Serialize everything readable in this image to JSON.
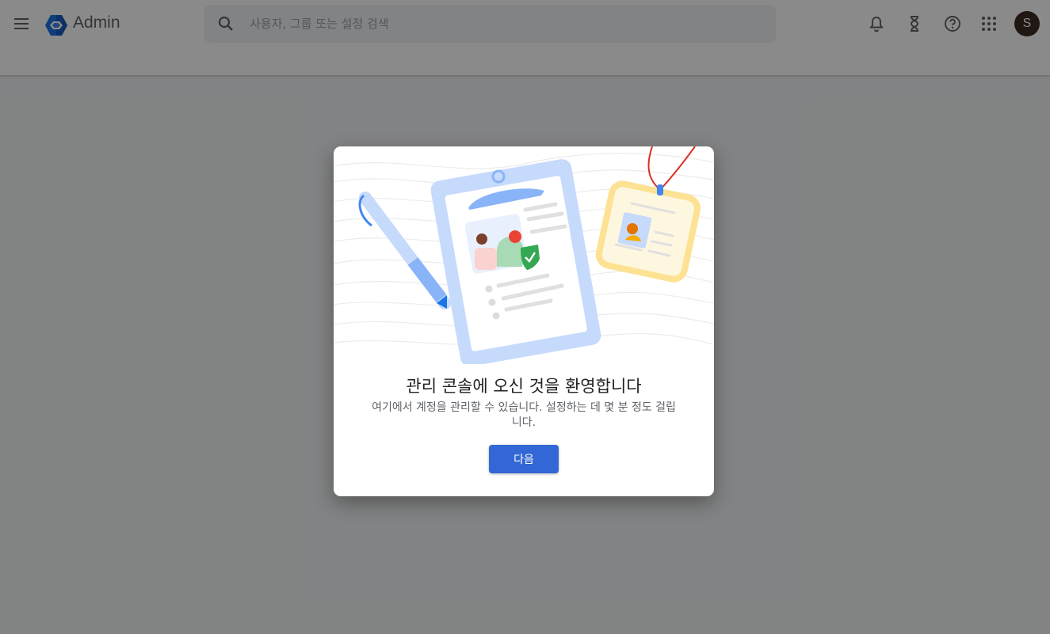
{
  "header": {
    "app_name": "Admin",
    "search_placeholder": "사용자, 그룹 또는 설정 검색",
    "avatar_initial": "S",
    "icons": [
      "menu-icon",
      "admin-logo-icon",
      "search-icon",
      "notifications-bell-icon",
      "tasks-hourglass-icon",
      "help-icon",
      "apps-grid-icon"
    ]
  },
  "dialog": {
    "title": "관리 콘솔에 오신 것을 환영합니다",
    "body_line1": "여기에서 계정을 관리할 수 있습니다. 설정하는 데 몇 분 정도 걸립",
    "body_line2": "니다.",
    "next_label": "다음"
  },
  "colors": {
    "primary_button": "#3367d6",
    "avatar": "#3b2a22",
    "scrim": "rgba(0,0,0,0.46)"
  }
}
